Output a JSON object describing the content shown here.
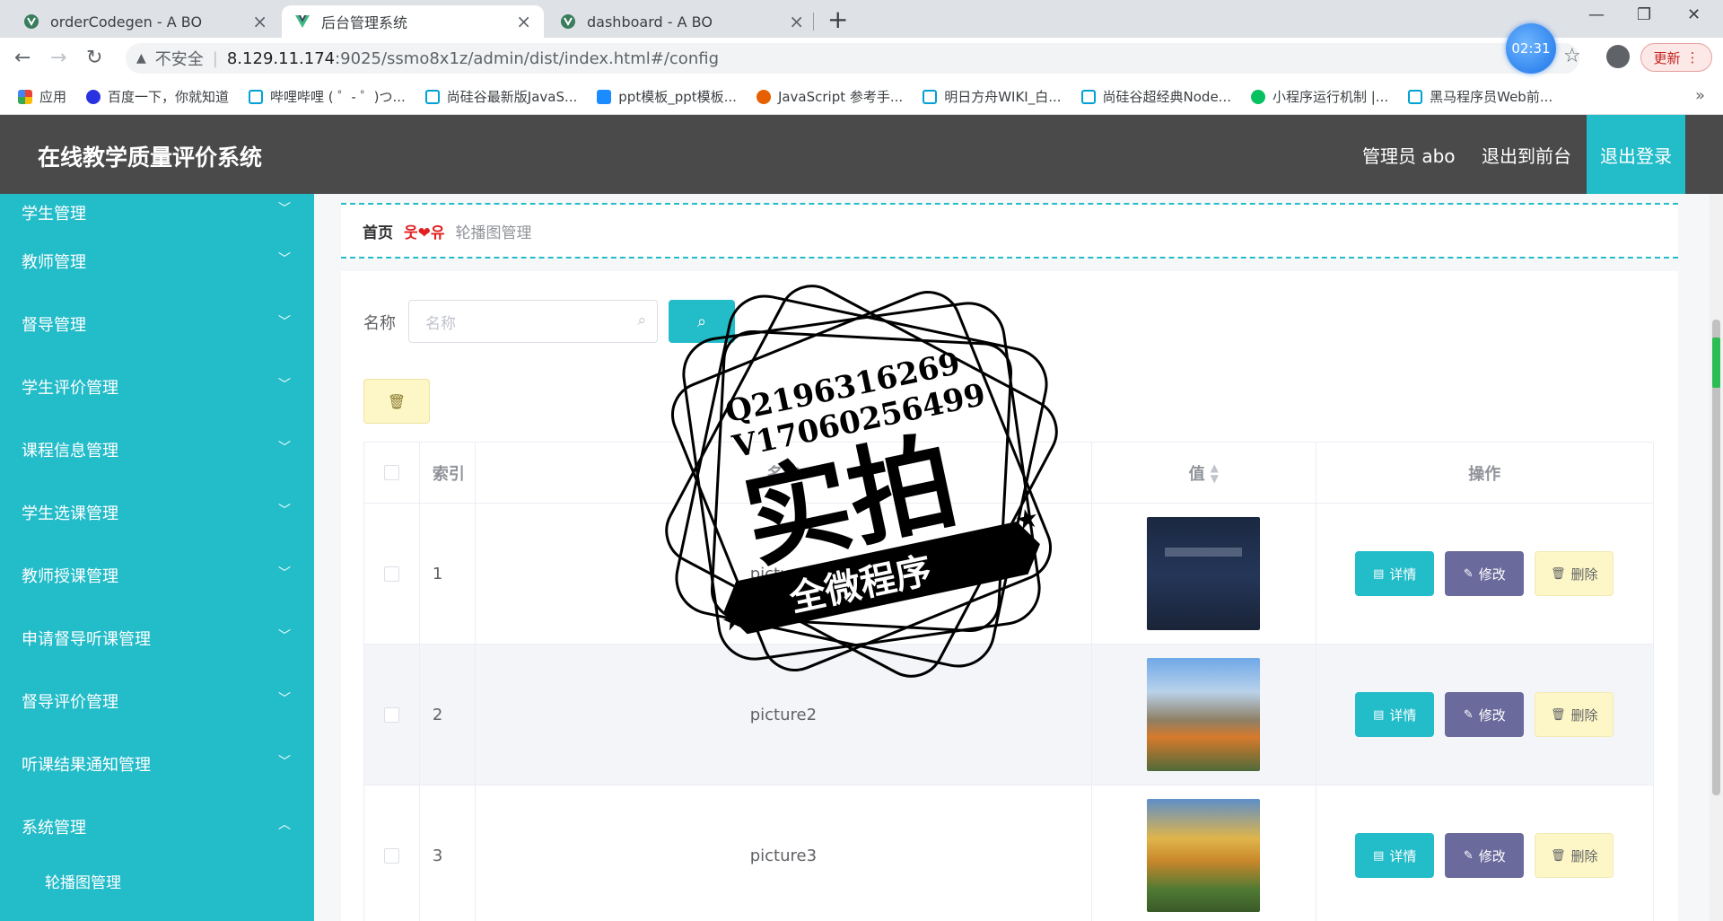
{
  "browser": {
    "tabs": [
      {
        "title": "orderCodegen - A BO",
        "active": false
      },
      {
        "title": "后台管理系统",
        "active": true
      },
      {
        "title": "dashboard - A BO",
        "active": false
      }
    ],
    "address": {
      "insecure_label": "不安全",
      "host": "8.129.11.174",
      "path": ":9025/ssmo8x1z/admin/dist/index.html#/config"
    },
    "timer": "02:31",
    "update_label": "更新",
    "bookmarks": [
      "应用",
      "百度一下，你就知道",
      "哔哩哔哩 ( ゜- ゜)つ...",
      "尚硅谷最新版JavaS...",
      "ppt模板_ppt模板...",
      "JavaScript 参考手...",
      "明日方舟WIKI_白...",
      "尚硅谷超经典Node...",
      "小程序运行机制 |...",
      "黑马程序员Web前..."
    ],
    "bookmarks_more": "»"
  },
  "header": {
    "title": "在线教学质量评价系统",
    "user": "管理员 abo",
    "to_front": "退出到前台",
    "logout": "退出登录"
  },
  "sidebar": {
    "items": [
      {
        "label": "学生管理",
        "chevron": "﹀"
      },
      {
        "label": "教师管理",
        "chevron": "﹀"
      },
      {
        "label": "督导管理",
        "chevron": "﹀"
      },
      {
        "label": "学生评价管理",
        "chevron": "﹀"
      },
      {
        "label": "课程信息管理",
        "chevron": "﹀"
      },
      {
        "label": "学生选课管理",
        "chevron": "﹀"
      },
      {
        "label": "教师授课管理",
        "chevron": "﹀"
      },
      {
        "label": "申请督导听课管理",
        "chevron": "﹀"
      },
      {
        "label": "督导评价管理",
        "chevron": "﹀"
      },
      {
        "label": "听课结果通知管理",
        "chevron": "﹀"
      },
      {
        "label": "系统管理",
        "chevron": "︿"
      }
    ],
    "subitem": "轮播图管理"
  },
  "breadcrumb": {
    "home": "首页",
    "separator": "웃❤유",
    "current": "轮播图管理"
  },
  "search": {
    "label": "名称",
    "placeholder": "名称"
  },
  "table": {
    "headers": {
      "index": "索引",
      "name": "名称",
      "value": "值",
      "actions": "操作"
    },
    "rows": [
      {
        "index": "1",
        "name": "picture1"
      },
      {
        "index": "2",
        "name": "picture2"
      },
      {
        "index": "3",
        "name": "picture3"
      }
    ],
    "actions": {
      "detail": "详情",
      "edit": "修改",
      "delete": "删除"
    }
  },
  "watermark": {
    "line1": "Q2196316269",
    "line2": "V17060256499",
    "big": "实拍",
    "ribbon": "全微程序"
  },
  "colors": {
    "accent": "#23bcc9",
    "header_bg": "#4a4a4a",
    "edit_btn": "#6a6a9c",
    "delete_btn": "#fdf6c6"
  }
}
